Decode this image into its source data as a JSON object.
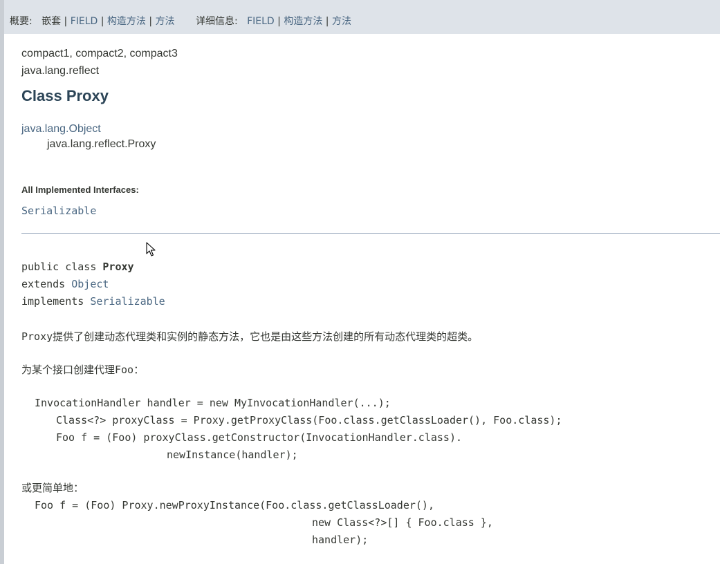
{
  "subnav": {
    "summary_label": "概要:",
    "summary_nested": "嵌套",
    "summary_field": "FIELD",
    "summary_constructor": "构造方法",
    "summary_method": "方法",
    "detail_label": "详细信息:",
    "detail_field": "FIELD",
    "detail_constructor": "构造方法",
    "detail_method": "方法",
    "separator": "|"
  },
  "header": {
    "profiles": "compact1, compact2, compact3",
    "package": "java.lang.reflect",
    "title": "Class Proxy"
  },
  "inheritance": {
    "parent": "java.lang.Object",
    "child": "java.lang.reflect.Proxy"
  },
  "interfaces": {
    "label": "All Implemented Interfaces:",
    "value": "Serializable"
  },
  "declaration": {
    "line1_prefix": "public class ",
    "line1_name": "Proxy",
    "line2_prefix": "extends ",
    "line2_link": "Object",
    "line3_prefix": "implements ",
    "line3_link": "Serializable"
  },
  "description": {
    "para1": "Proxy提供了创建动态代理类和实例的静态方法，它也是由这些方法创建的所有动态代理类的超类。",
    "para2": "为某个接口创建代理Foo：",
    "code1": [
      "InvocationHandler handler = new MyInvocationHandler(...);",
      "Class<?> proxyClass = Proxy.getProxyClass(Foo.class.getClassLoader(), Foo.class);",
      "Foo f = (Foo) proxyClass.getConstructor(InvocationHandler.class).",
      "newInstance(handler);"
    ],
    "para3": "或更简单地：",
    "code2": [
      "Foo f = (Foo) Proxy.newProxyInstance(Foo.class.getClassLoader(),",
      "new Class<?>[] { Foo.class },",
      "handler);"
    ]
  }
}
